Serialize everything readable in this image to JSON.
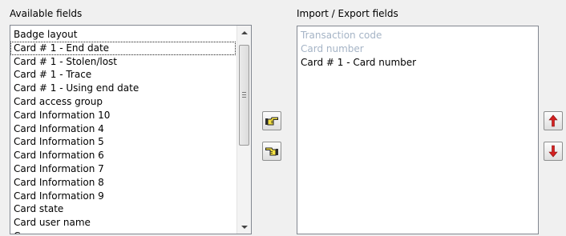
{
  "available": {
    "label": "Available fields",
    "items": [
      "Badge layout",
      "Card # 1 - End date",
      "Card # 1 - Stolen/lost",
      "Card # 1 - Trace",
      "Card # 1 - Using end date",
      "Card access group",
      "Card Information 10",
      "Card Information 4",
      "Card Information 5",
      "Card Information 6",
      "Card Information 7",
      "Card Information 8",
      "Card Information 9",
      "Card state",
      "Card user name",
      "Company"
    ],
    "focused_item": "Card # 1 - End date"
  },
  "import_export": {
    "label": "Import / Export fields",
    "items": [
      {
        "label": "Transaction code",
        "enabled": false
      },
      {
        "label": "Card number",
        "enabled": false
      },
      {
        "label": "Card # 1 - Card number",
        "enabled": true
      }
    ]
  },
  "buttons": {
    "add_icon": "hand-pointing-right-icon",
    "remove_icon": "hand-pointing-left-icon",
    "move_up_icon": "red-arrow-up-icon",
    "move_down_icon": "red-arrow-down-icon"
  },
  "colors": {
    "window_bg": "#f0f0f0",
    "disabled_text": "#a5b4c6",
    "arrow_red": "#d32020",
    "hand_yellow": "#f5e142"
  }
}
